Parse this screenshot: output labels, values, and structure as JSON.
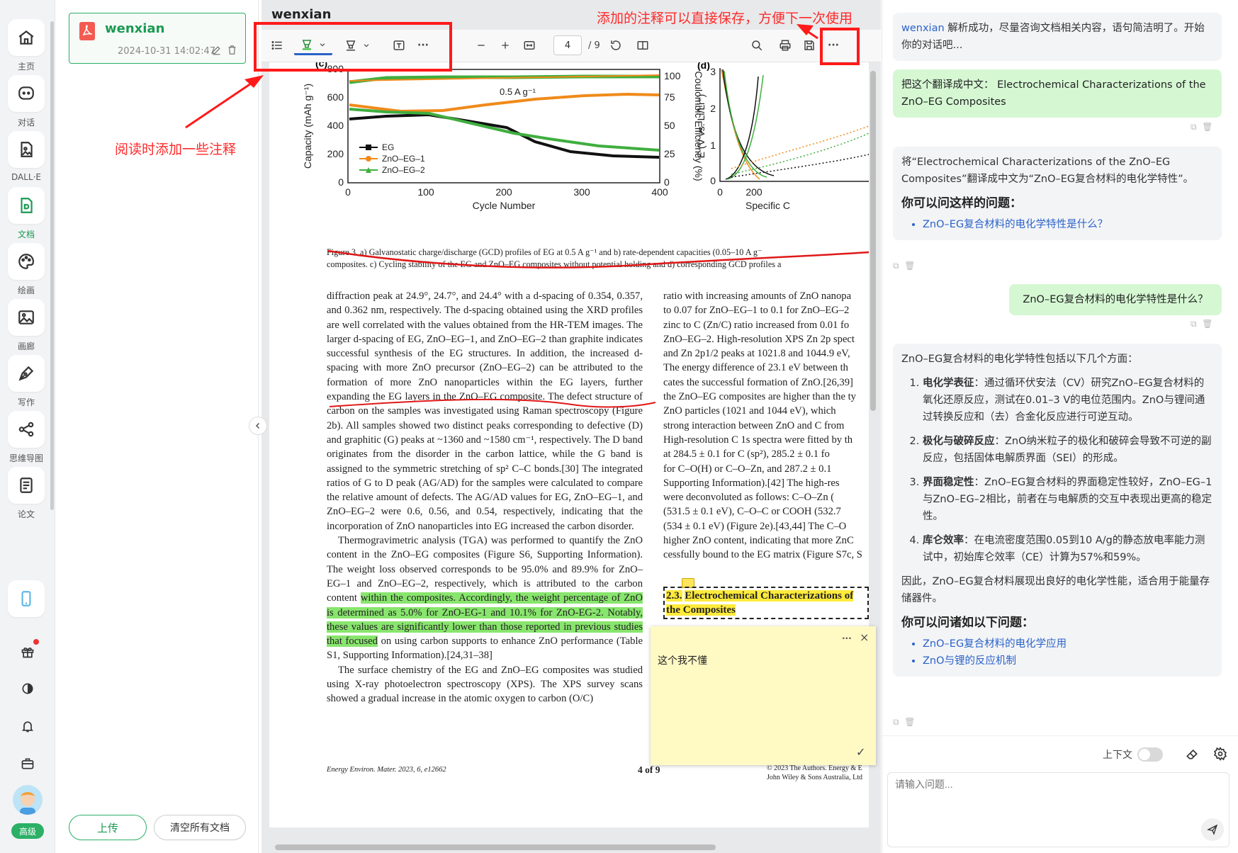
{
  "sidebar": {
    "items": [
      {
        "label": "主页",
        "icon": "home-icon"
      },
      {
        "label": "对话",
        "icon": "chat-icon"
      },
      {
        "label": "DALL·E",
        "icon": "image-gen-icon"
      },
      {
        "label": "文档",
        "icon": "document-icon"
      },
      {
        "label": "绘画",
        "icon": "palette-icon"
      },
      {
        "label": "画廊",
        "icon": "gallery-icon"
      },
      {
        "label": "写作",
        "icon": "pen-icon"
      },
      {
        "label": "思维导图",
        "icon": "mindmap-icon"
      },
      {
        "label": "论文",
        "icon": "paper-icon"
      }
    ],
    "active_index": 3,
    "bottom_icons": [
      "gift-icon",
      "theme-icon",
      "bell-icon",
      "briefcase-icon"
    ],
    "plan_badge": "高级"
  },
  "doc_list": {
    "doc_name": "wenxian",
    "doc_date": "2024-10-31 14:02:47",
    "upload_label": "上传",
    "clear_label": "清空所有文档"
  },
  "viewer": {
    "title": "wenxian",
    "page_current": "4",
    "page_total": "/ 9"
  },
  "pdf": {
    "chart_c": {
      "panel": "(c)",
      "legend": [
        "EG",
        "ZnO–EG–1",
        "ZnO–EG–2"
      ],
      "rate_label": "0.5 A g⁻¹",
      "xlabel": "Cycle Number",
      "ylabel": "Capacity (mAh g⁻¹)",
      "y2label": "Coulombic Efficiency (%)",
      "xticks": [
        "0",
        "100",
        "200",
        "300",
        "400"
      ],
      "yticks": [
        "0",
        "200",
        "400",
        "600",
        "800"
      ],
      "y2ticks": [
        "0",
        "25",
        "50",
        "75",
        "100"
      ]
    },
    "chart_d": {
      "panel": "(d)",
      "ylabel": "E (V vs. Li/Li⁺)",
      "xlabel": "Specific C",
      "xticks": [
        "0",
        "200"
      ],
      "yticks": [
        "0",
        "1",
        "2",
        "3"
      ]
    },
    "caption_l1": "Figure 3.  a) Galvanostatic charge/discharge (GCD) profiles of EG at 0.5 A g⁻¹ and b) rate-dependent capacities (0.05–10 A g⁻",
    "caption_l2": "composites. c) Cycling stability of the EG and ZnO–EG composites without potential holding and d) corresponding GCD profiles a",
    "left_p1": "diffraction peak at 24.9°, 24.7°, and 24.4° with a d-spacing of 0.354, 0.357, and 0.362 nm, respectively. The d-spacing obtained using the XRD profiles are well correlated with the values obtained from the HR-TEM images. The larger d-spacing of EG, ZnO–EG–1, and ZnO–EG–2 than graphite indicates successful synthesis of the EG structures. In addition, the increased d-spacing with more ZnO precursor (ZnO–EG–2) can be attributed to the formation of more ZnO nanoparticles within the EG layers, further expanding the EG layers in the ZnO–EG composite. The defect structure of carbon on the samples was investigated using Raman spectroscopy (Figure 2b). All samples showed two distinct peaks corresponding to defective (D) and graphitic (G) peaks at ~1360 and ~1580 cm⁻¹, respectively. The D band originates from the disorder in the carbon lattice, while the G band is assigned to the symmetric stretching of sp² C–C bonds.[30] The integrated ratios of G to D peak (AG/AD) for the samples were calculated to compare the relative amount of defects. The AG/AD values for EG, ZnO–EG–1, and ZnO–EG–2 were 0.6, 0.56, and 0.54, respectively, indicating that the incorporation of ZnO nanoparticles into EG increased the carbon disorder.",
    "left_p2_a": "Thermogravimetric analysis (TGA) was performed to quantify the ZnO content in the ZnO–EG composites (Figure S6, Supporting Information). The weight loss observed corresponds to be 95.0% and 89.9% for ZnO–EG–1 and ZnO–EG–2, respectively, which is attributed to the carbon content ",
    "left_p2_hl": "within the composites. Accordingly, the weight percentage of ZnO is determined as 5.0% for ZnO-EG-1 and 10.1% for ZnO-EG-2. Notably, these values are significantly lower than those reported in previous studies that focused",
    "left_p2_b": " on using carbon supports to enhance ZnO performance (Table S1, Supporting Information).[24,31–38]",
    "left_p3": "The surface chemistry of the EG and ZnO–EG composites was studied using X-ray photoelectron spectroscopy (XPS). The XPS survey scans showed a gradual increase in the atomic oxygen to carbon (O/C)",
    "right_lines": [
      "ratio with increasing amounts of ZnO nanopa",
      "to 0.07 for ZnO–EG–1 to 0.1 for ZnO–EG–2",
      "zinc to C (Zn/C) ratio increased from 0.01 fo",
      "ZnO–EG–2. High-resolution XPS Zn 2p spect",
      "and Zn 2p1/2 peaks at 1021.8 and 1044.9 eV,",
      "The energy difference of 23.1 eV between th",
      "cates the successful formation of ZnO.[26,39]",
      "the ZnO–EG composites are higher than the ty",
      "ZnO particles (1021 and 1044 eV), which",
      "strong interaction between ZnO and C from",
      "High-resolution C 1s spectra were fitted by th",
      "at 284.5 ± 0.1 for C (sp²), 285.2 ± 0.1 fo",
      "for C–O(H) or C–O–Zn, and 287.2 ± 0.1",
      "Supporting Information).[42]  The high-res",
      "were deconvoluted as follows: C–O–Zn (",
      "(531.5 ± 0.1 eV), C–O–C or COOH (532.7",
      "(534 ± 0.1 eV) (Figure 2e).[43,44] The C–O",
      "higher ZnO content, indicating that more ZnC",
      "cessfully bound to the EG matrix (Figure S7c, S"
    ],
    "section_num": "2.3.",
    "section_title": "Electrochemical Characterizations of the Composites",
    "footer_left": "Energy Environ. Mater. 2023, 6, e12662",
    "footer_center": "4 of 9",
    "footer_right_1": "© 2023 The Authors. Energy & E",
    "footer_right_2": "John Wiley & Sons Australia, Ltd"
  },
  "note": {
    "text": "这个我不懂",
    "more": "···",
    "close": "×",
    "confirm": "✓"
  },
  "annotations": {
    "save_hint": "添加的注释可以直接保存，方便下一次使用",
    "annot_hint": "阅读时添加一些注释"
  },
  "chat": {
    "intro_name": "wenxian",
    "intro_text": " 解析成功，尽量咨询文档相关内容，语句简洁明了。开始你的对话吧...",
    "user_q1": "把这个翻译成中文： Electrochemical Characterizations of the ZnO–EG Composites",
    "ai_a1": "将“Electrochemical Characterizations of the ZnO–EG Composites”翻译成中文为“ZnO–EG复合材料的电化学特性”。",
    "ai_a1_heading": "你可以问这样的问题：",
    "ai_a1_suggest": "ZnO–EG复合材料的电化学特性是什么？",
    "user_q2": "ZnO–EG复合材料的电化学特性是什么？",
    "ai_a2_intro": "ZnO–EG复合材料的电化学特性包括以下几个方面：",
    "ai_a2_items": [
      {
        "title": "电化学表征",
        "text": "：通过循环伏安法（CV）研究ZnO–EG复合材料的氧化还原反应，测试在0.01–3 V的电位范围内。ZnO与锂间通过转换反应和（去）合金化反应进行可逆互动。"
      },
      {
        "title": "极化与破碎反应",
        "text": "：ZnO纳米粒子的极化和破碎会导致不可逆的副反应，包括固体电解质界面（SEI）的形成。"
      },
      {
        "title": "界面稳定性",
        "text": "：ZnO–EG复合材料的界面稳定性较好，ZnO–EG–1与ZnO–EG–2相比，前者在与电解质的交互中表现出更高的稳定性。"
      },
      {
        "title": "库仑效率",
        "text": "：在电流密度范围0.05到10 A/g的静态放电率能力测试中，初始库仑效率（CE）计算为57%和59%。"
      }
    ],
    "ai_a2_summary": "因此，ZnO–EG复合材料展现出良好的电化学性能，适合用于能量存储器件。",
    "ai_a2_heading": "你可以问诸如以下问题：",
    "ai_a2_suggest": [
      "ZnO–EG复合材料的电化学应用",
      "ZnO与锂的反应机制"
    ],
    "context_label": "上下文",
    "input_placeholder": "请输入问题..."
  },
  "colors": {
    "brand_green": "#1a9a52",
    "user_bubble": "#d5f8d3",
    "annotation_red": "#ff1a1a",
    "highlight_green": "#88e56d",
    "note_yellow": "#fff9c4"
  }
}
